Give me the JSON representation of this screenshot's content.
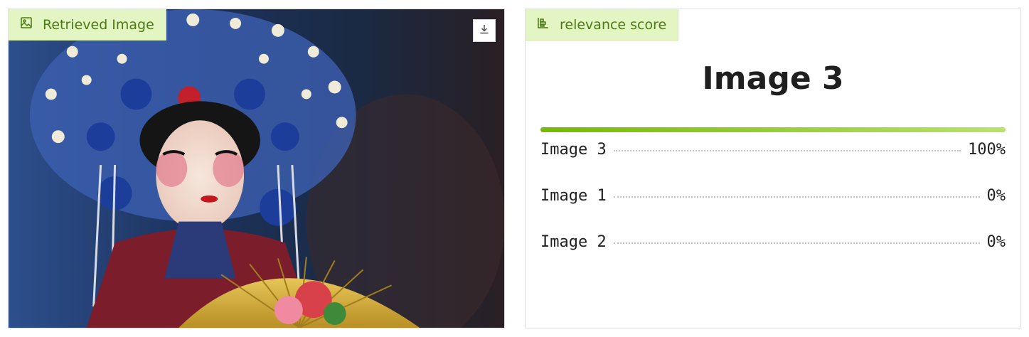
{
  "image_panel": {
    "tag_label": "Retrieved Image",
    "tag_icon": "image-icon",
    "download_icon": "download-icon"
  },
  "score_panel": {
    "tag_label": "relevance score",
    "tag_icon": "bar-chart-icon",
    "top_label": "Image 3",
    "accent_color": "#76b900",
    "rows": [
      {
        "label": "Image 3",
        "value": "100%"
      },
      {
        "label": "Image 1",
        "value": "0%"
      },
      {
        "label": "Image 2",
        "value": "0%"
      }
    ]
  }
}
